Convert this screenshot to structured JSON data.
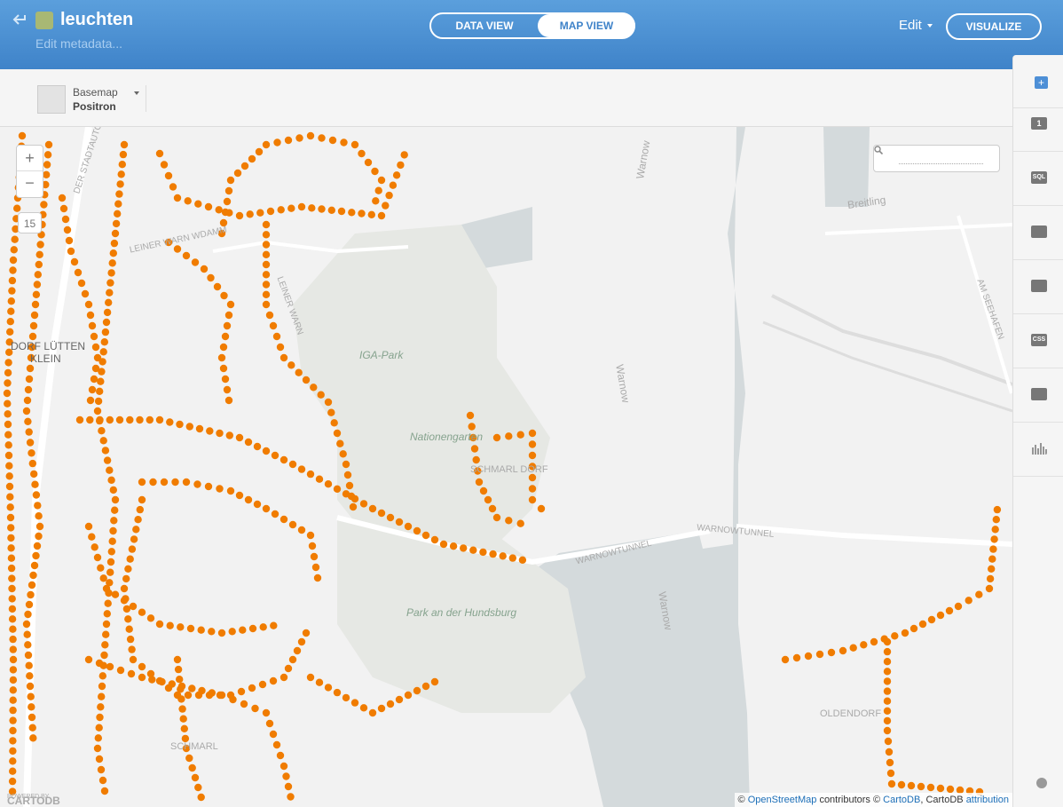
{
  "header": {
    "title": "leuchten",
    "subtitle": "Edit metadata...",
    "tab_data": "DATA VIEW",
    "tab_map": "MAP VIEW",
    "edit_label": "Edit",
    "visualize_label": "VISUALIZE"
  },
  "toolbar": {
    "basemap_label": "Basemap",
    "basemap_value": "Positron"
  },
  "map": {
    "zoom_in": "+",
    "zoom_out": "−",
    "zoom_level": "15",
    "labels": {
      "warnow_top": "Warnow",
      "breitling": "Breitling",
      "iga_park": "IGA-Park",
      "warnow_mid": "Warnow",
      "am_seehafen": "AM SEEHAFEN",
      "dorf_lutten": "DORF LÜTTEN",
      "klein": "KLEIN",
      "nationengarten": "Nationengarten",
      "schmarl_dorf": "SCHMARL DORF",
      "warnowtunnel_left": "WARNOWTUNNEL",
      "warnowtunnel_right": "WARNOWTUNNEL",
      "park_hundsburg": "Park an der Hundsburg",
      "warnow_bottom": "Warnow",
      "oldendorf": "OLDENDORF",
      "schmarl": "SCHMARL",
      "stadtautobahn": "DER STADTAUTO",
      "kleiner_warnowdamm": "LEINER WARN  WDAMM",
      "kleiner_warnowdamm2": "LEINER WARN"
    },
    "point_color": "#f07c00",
    "water_color": "#d4dadc"
  },
  "attribution": {
    "prefix": "©",
    "osm": "OpenStreetMap",
    "contributors": "contributors ©",
    "cartodb": "CartoDB",
    "cartodb_plain": ", CartoDB",
    "attribution_link": "attribution"
  },
  "branding": {
    "powered_by": "POWERED BY",
    "logo": "CARTODB"
  },
  "rightbar": {
    "layer_number": "1",
    "sql": "SQL",
    "css": "CSS"
  }
}
